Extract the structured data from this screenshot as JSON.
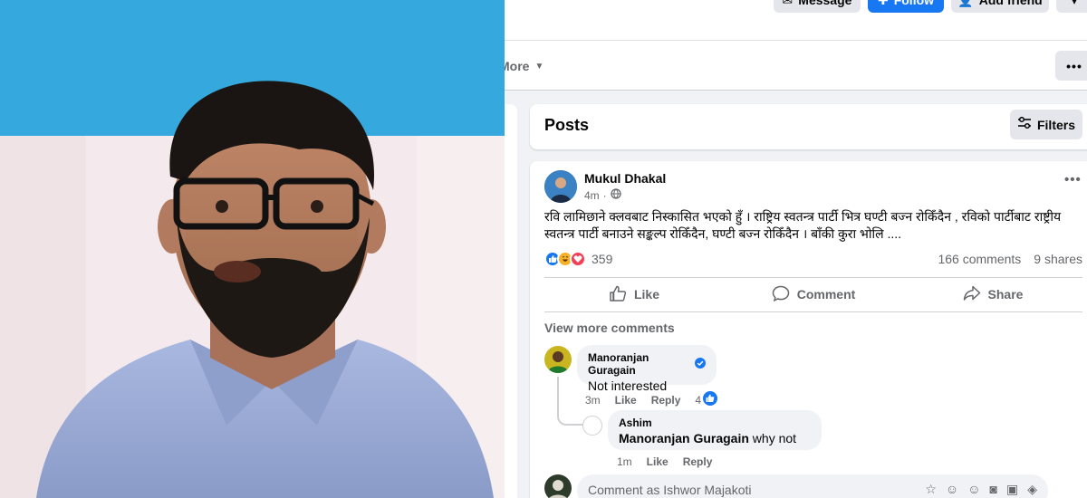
{
  "header": {
    "message_label": "Message",
    "follow_label": "Follow",
    "add_friend_label": "Add friend",
    "more_tab_label": "More",
    "more_options_label": "•••"
  },
  "posts_section": {
    "title": "Posts",
    "filters_label": "Filters"
  },
  "post": {
    "author": "Mukul Dhakal",
    "time": "4m",
    "menu_label": "•••",
    "text": "रवि लामिछाने क्लवबाट निस्कासित भएको हुँ । राष्ट्रिय स्वतन्त्र पार्टी भित्र घण्टी बज्न रोकिँदैन , रविको पार्टीबाट राष्ट्रीय स्वतन्त्र पार्टी बनाउने सङ्कल्प रोकिँदैन, घण्टी बज्न रोकिँदैन । बाँकी कुरा भोलि ....",
    "reaction_count": "359",
    "comments_count": "166 comments",
    "shares_count": "9 shares",
    "like_label": "Like",
    "comment_label": "Comment",
    "share_label": "Share",
    "view_more_comments": "View more comments"
  },
  "comments": [
    {
      "author": "Manoranjan Guragain",
      "verified": true,
      "text": "Not interested",
      "time": "3m",
      "like_label": "Like",
      "reply_label": "Reply",
      "like_count": "4"
    }
  ],
  "reply": {
    "author": "Ashim",
    "mention": "Manoranjan Guragain",
    "text": " why not",
    "time": "1m",
    "like_label": "Like",
    "reply_label": "Reply"
  },
  "composer": {
    "placeholder": "Comment as Ishwor Majakoti"
  },
  "colors": {
    "brand_blue": "#1877f2",
    "sky_blue": "#35a9dd",
    "shirt": "#9fb0d8"
  }
}
